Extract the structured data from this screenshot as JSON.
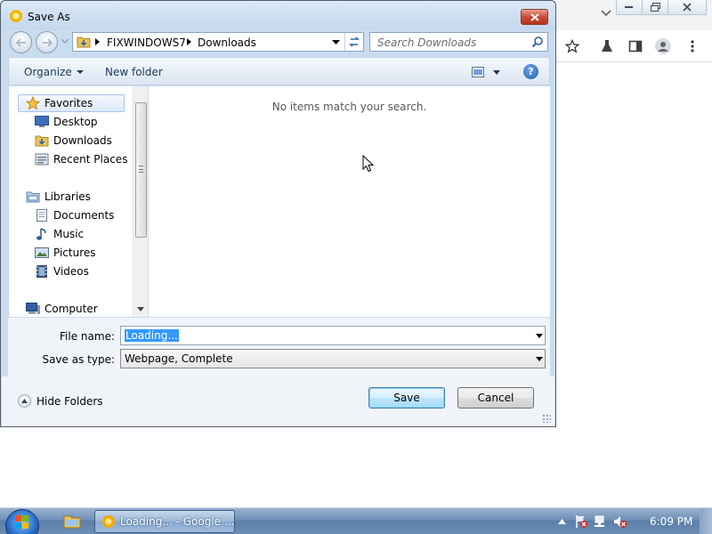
{
  "dialog": {
    "title": "Save As",
    "address": {
      "crumbs": [
        "FIXWINDOWS7",
        "Downloads"
      ]
    },
    "search": {
      "placeholder": "Search Downloads"
    },
    "toolbar": {
      "organize_label": "Organize",
      "new_folder_label": "New folder"
    },
    "nav_tree": {
      "favorites_label": "Favorites",
      "favorites": [
        {
          "label": "Desktop",
          "icon": "desktop-icon"
        },
        {
          "label": "Downloads",
          "icon": "downloads-folder-icon"
        },
        {
          "label": "Recent Places",
          "icon": "recent-places-icon"
        }
      ],
      "libraries_label": "Libraries",
      "libraries": [
        {
          "label": "Documents",
          "icon": "documents-icon"
        },
        {
          "label": "Music",
          "icon": "music-icon"
        },
        {
          "label": "Pictures",
          "icon": "pictures-icon"
        },
        {
          "label": "Videos",
          "icon": "videos-icon"
        }
      ],
      "computer_label": "Computer"
    },
    "content": {
      "empty_message": "No items match your search."
    },
    "file_name": {
      "label": "File name:",
      "value": "Loading..."
    },
    "save_type": {
      "label": "Save as type:",
      "value": "Webpage, Complete"
    },
    "footer": {
      "hide_folders_label": "Hide Folders",
      "save_label": "Save",
      "cancel_label": "Cancel"
    }
  },
  "taskbar": {
    "task_label": "Loading... - Google ...",
    "clock": "6:09 PM"
  },
  "colors": {
    "dialog_frame": "#c9dcf0",
    "selection": "#3399ff",
    "close_button": "#c74c36",
    "taskbar": "#6d8fb7"
  }
}
